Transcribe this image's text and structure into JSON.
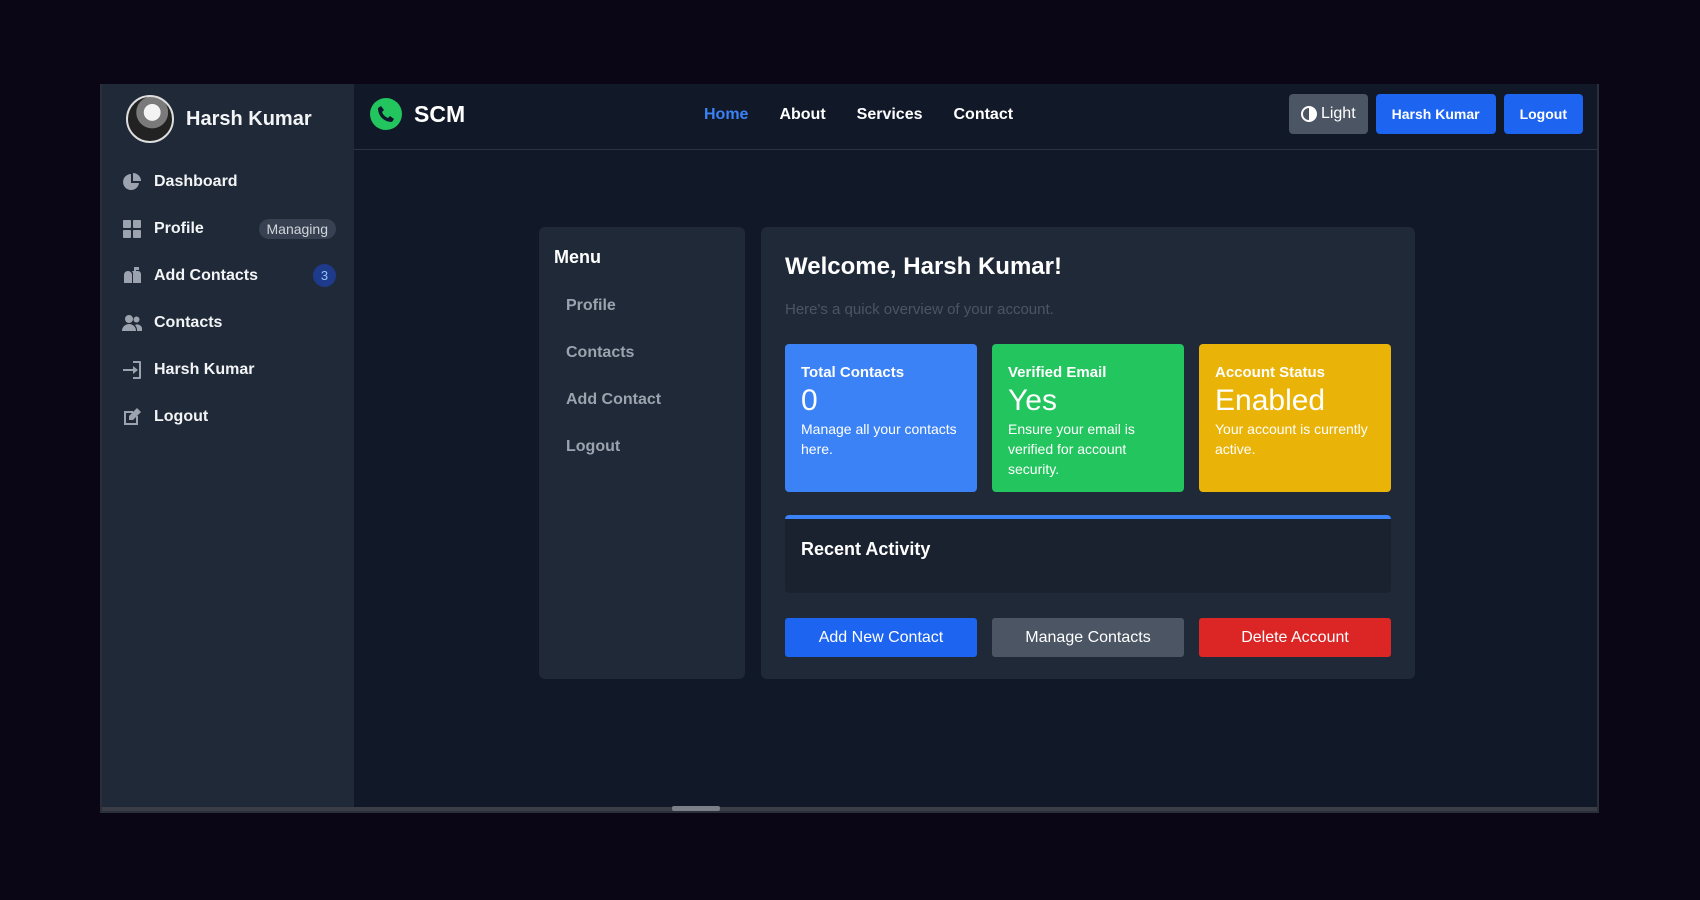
{
  "sidebar": {
    "user_name": "Harsh Kumar",
    "items": [
      {
        "label": "Dashboard",
        "icon": "pie-chart-icon"
      },
      {
        "label": "Profile",
        "icon": "grid-icon",
        "pill": "Managing"
      },
      {
        "label": "Add Contacts",
        "icon": "mailbox-icon",
        "badge": "3"
      },
      {
        "label": "Contacts",
        "icon": "users-icon"
      },
      {
        "label": "Harsh Kumar",
        "icon": "login-icon"
      },
      {
        "label": "Logout",
        "icon": "edit-icon"
      }
    ]
  },
  "topbar": {
    "brand": "SCM",
    "brand_icon": "phone-icon",
    "nav": [
      "Home",
      "About",
      "Services",
      "Contact"
    ],
    "active_nav": "Home",
    "theme_label": "Light",
    "user_button": "Harsh Kumar",
    "logout_button": "Logout"
  },
  "menu": {
    "title": "Menu",
    "items": [
      "Profile",
      "Contacts",
      "Add Contact",
      "Logout"
    ]
  },
  "main": {
    "welcome": "Welcome, Harsh Kumar!",
    "subtitle": "Here's a quick overview of your account.",
    "stats": [
      {
        "title": "Total Contacts",
        "value": "0",
        "desc": "Manage all your contacts here.",
        "color": "#3b82f6"
      },
      {
        "title": "Verified Email",
        "value": "Yes",
        "desc": "Ensure your email is verified for account security.",
        "color": "#22c55e"
      },
      {
        "title": "Account Status",
        "value": "Enabled",
        "desc": "Your account is currently active.",
        "color": "#eab308"
      }
    ],
    "activity_title": "Recent Activity",
    "actions": [
      "Add New Contact",
      "Manage Contacts",
      "Delete Account"
    ]
  },
  "colors": {
    "accent": "#3b82f6",
    "primary_button": "#1d64f0",
    "danger": "#dc2626",
    "success": "#22c55e",
    "warning": "#eab308"
  }
}
